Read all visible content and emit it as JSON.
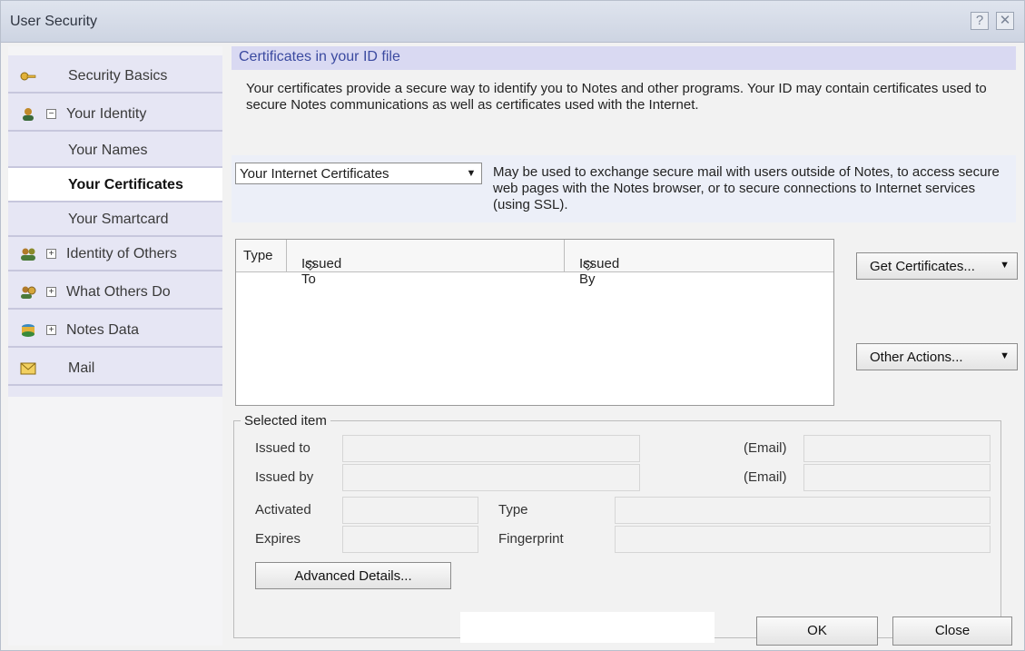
{
  "window": {
    "title": "User Security",
    "help_label": "?",
    "close_label": "✕"
  },
  "nav": {
    "items": [
      {
        "label": "Security Basics",
        "icon": "key-icon"
      },
      {
        "label": "Your Identity",
        "icon": "user-icon",
        "expander": "⊟"
      },
      {
        "label": "Your Names"
      },
      {
        "label": "Your Certificates",
        "selected": true
      },
      {
        "label": "Your Smartcard"
      },
      {
        "label": "Identity of Others",
        "icon": "people-icon",
        "expander": "⊞"
      },
      {
        "label": "What Others Do",
        "icon": "people-gear-icon",
        "expander": "⊞"
      },
      {
        "label": "Notes Data",
        "icon": "database-icon",
        "expander": "⊞"
      },
      {
        "label": "Mail",
        "icon": "mail-icon"
      }
    ]
  },
  "content": {
    "header": "Certificates in your ID file",
    "description": "Your certificates provide a secure way to identify you to Notes and other programs. Your ID may contain certificates used to secure Notes communications as well as certificates used with the Internet.",
    "cert_type_select": "Your Internet Certificates",
    "cert_type_description": "May be used to exchange secure mail with users outside of Notes, to access secure web pages with the Notes browser, or to secure connections to Internet services (using SSL).",
    "table": {
      "columns": [
        "Type",
        "Issued To",
        "Issued By"
      ]
    },
    "get_certificates_label": "Get Certificates...",
    "other_actions_label": "Other Actions...",
    "selected_item": {
      "legend": "Selected item",
      "issued_to_label": "Issued to",
      "issued_by_label": "Issued by",
      "email_label": "(Email)",
      "activated_label": "Activated",
      "expires_label": "Expires",
      "type_label": "Type",
      "fingerprint_label": "Fingerprint",
      "advanced_details_label": "Advanced Details..."
    }
  },
  "footer": {
    "ok_label": "OK",
    "close_label": "Close"
  },
  "colors": {
    "nav_bg": "#e6e6f4",
    "header_band": "#d9d9f2",
    "header_text": "#3b4aa0"
  }
}
